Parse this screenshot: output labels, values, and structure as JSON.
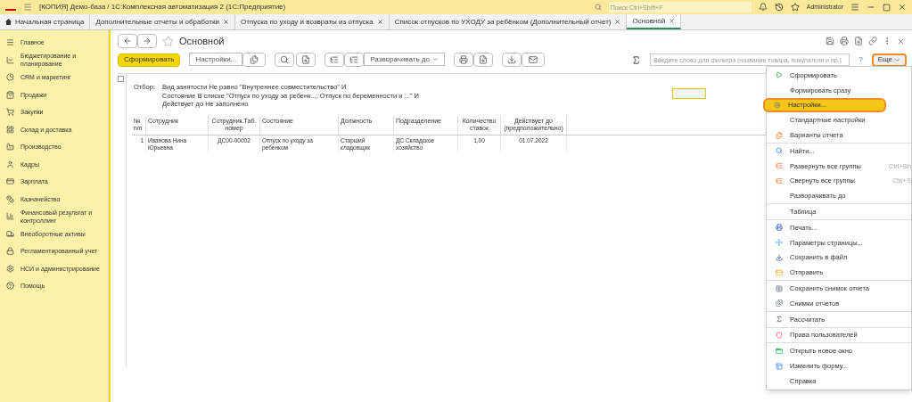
{
  "window": {
    "title": "[КОПИЯ] Демо-база / 1С:Комплексная автоматизация 2  (1С:Предприятие)",
    "search_placeholder": "Поиск Ctrl+Shift+F",
    "user": "Administrator"
  },
  "tabs": [
    {
      "label": "Начальная страница",
      "selected": false,
      "closable": false
    },
    {
      "label": "Дополнительные отчеты и обработки",
      "selected": false,
      "closable": true
    },
    {
      "label": "Отпуска по уходу и возвраты из отпуска",
      "selected": false,
      "closable": true
    },
    {
      "label": "Список отпусков по УХОДУ за ребёнком (Дополнительный отчет)",
      "selected": false,
      "closable": true
    },
    {
      "label": "Основной",
      "selected": true,
      "closable": true
    }
  ],
  "sidebar": {
    "items": [
      "Главное",
      "Бюджетирование и планирование",
      "CRM и маркетинг",
      "Продажи",
      "Закупки",
      "Склад и доставка",
      "Производство",
      "Кадры",
      "Зарплата",
      "Казначейство",
      "Финансовый результат и контроллинг",
      "Внеоборотные активы",
      "Регламентированный учет",
      "НСИ и администрирование",
      "Помощь"
    ]
  },
  "form": {
    "title": "Основной",
    "generate": "Сформировать",
    "settings": "Настройки...",
    "expand_to": "Разворачивать до",
    "filter_placeholder": "Введите слово для фильтра (название товара, покупателя и пр.)",
    "help": "?",
    "more": "Еще"
  },
  "report": {
    "filter_label": "Отбор:",
    "filter_lines": [
      "Вид занятости Не равно \"Внутреннее совместительство\" И",
      "Состояние В списке \"Отпуск по уходу за ребенк...; Отпуск по беременности и ...\" И",
      "Действует до Не заполнено"
    ],
    "columns": [
      "№ п/п",
      "Сотрудник",
      "Сотрудник.Таб. номер",
      "Состояние",
      "Должность",
      "Подразделение",
      "Количество ставок",
      "Действует до (предположительно)"
    ],
    "rows": [
      [
        "1",
        "Иванова Нина Юрьевна",
        "ДС00-00002",
        "Отпуск по уходу за ребенком",
        "Старший кладовщик",
        "ДС Складское хозяйство",
        "1,00",
        "01.07.2022"
      ]
    ]
  },
  "menu": {
    "groups": [
      [
        {
          "label": "Сформировать",
          "selected": false
        },
        {
          "label": "Формировать сразу",
          "selected": false
        },
        {
          "label": "Настройки...",
          "selected": true
        },
        {
          "label": "Стандартные настройки",
          "selected": false
        },
        {
          "label": "Варианты отчета",
          "selected": false
        }
      ],
      [
        {
          "label": "Найти...",
          "selected": false
        },
        {
          "label": "Развернуть все группы",
          "shortcut": "Ctrl+Sh",
          "selected": false
        },
        {
          "label": "Свернуть все группы",
          "shortcut": "Ctrl+S",
          "selected": false
        },
        {
          "label": "Разворачивать до",
          "selected": false
        }
      ],
      [
        {
          "label": "Таблица",
          "selected": false
        }
      ],
      [
        {
          "label": "Печать...",
          "selected": false
        },
        {
          "label": "Параметры страницы...",
          "selected": false
        },
        {
          "label": "Сохранить в файл",
          "selected": false
        },
        {
          "label": "Отправить",
          "selected": false
        }
      ],
      [
        {
          "label": "Сохранить снимок отчета",
          "selected": false
        },
        {
          "label": "Снимки отчетов",
          "selected": false
        }
      ],
      [
        {
          "label": "Рассчитать",
          "selected": false
        }
      ],
      [
        {
          "label": "Права пользователей",
          "selected": false
        }
      ],
      [
        {
          "label": "Открыть новое окно",
          "selected": false
        },
        {
          "label": "Изменить форму...",
          "selected": false
        },
        {
          "label": "Справка",
          "selected": false
        }
      ]
    ]
  }
}
